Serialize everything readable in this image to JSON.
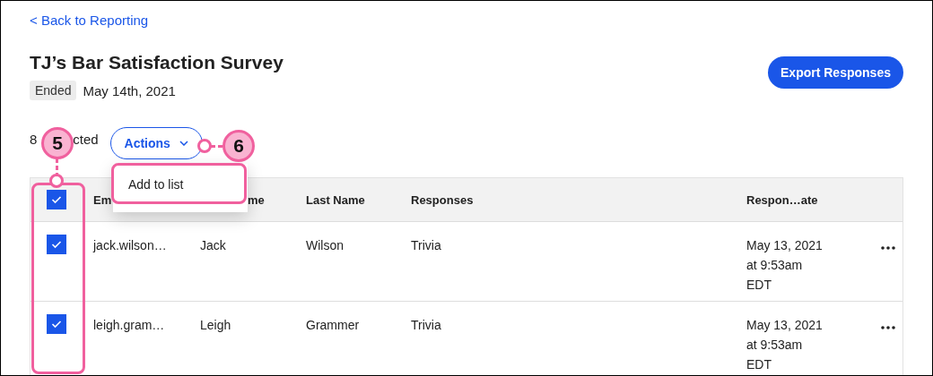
{
  "back_link": "< Back to Reporting",
  "title": "TJ’s Bar Satisfaction Survey",
  "status_badge": "Ended",
  "date": "May 14th, 2021",
  "export_button": "Export Responses",
  "selection_count_parts": [
    "8",
    "cted"
  ],
  "actions_button": "Actions",
  "actions_menu": {
    "open": true,
    "items": [
      "Add to list"
    ]
  },
  "table": {
    "select_all_checked": true,
    "columns": [
      "Em",
      "me",
      "Last Name",
      "Responses",
      "Respon…ate"
    ],
    "rows": [
      {
        "checked": true,
        "email": "jack.wilson…",
        "first_name": "Jack",
        "last_name": "Wilson",
        "responses": "Trivia",
        "date": "May 13, 2021\nat 9:53am\nEDT"
      },
      {
        "checked": true,
        "email": "leigh.gram…",
        "first_name": "Leigh",
        "last_name": "Grammer",
        "responses": "Trivia",
        "date": "May 13, 2021\nat 9:53am\nEDT"
      }
    ]
  },
  "callouts": [
    {
      "number": "5"
    },
    {
      "number": "6"
    }
  ]
}
